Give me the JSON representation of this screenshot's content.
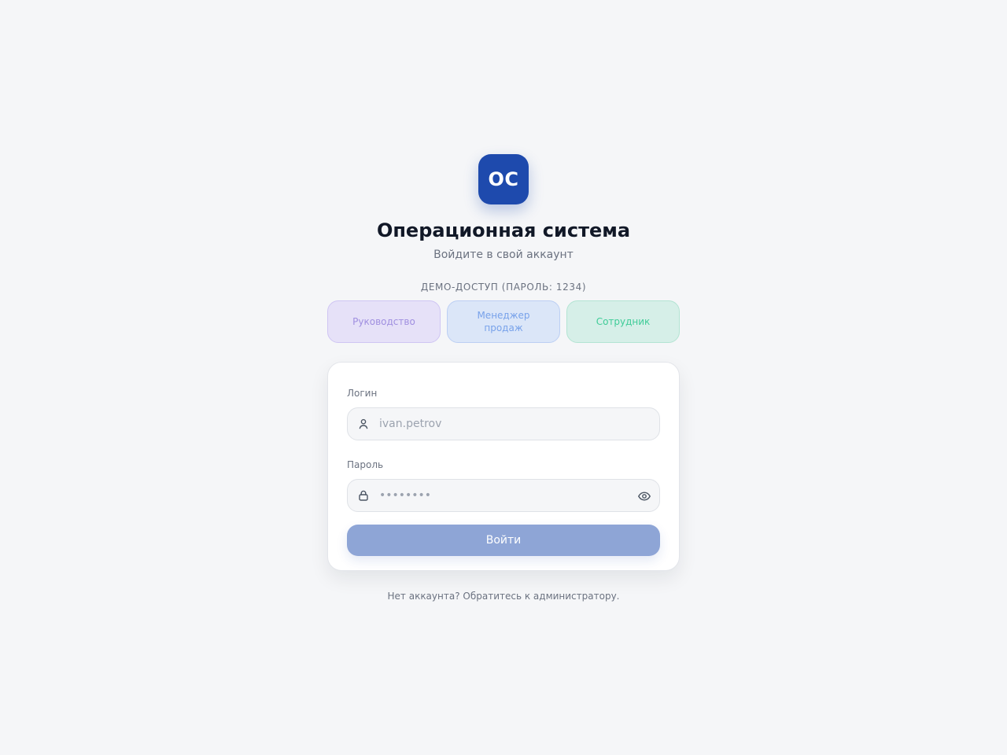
{
  "app": {
    "logo_text": "ОС",
    "title": "Операционная система",
    "subtitle": "Войдите в свой аккаунт"
  },
  "demo": {
    "label": "ДЕМО-ДОСТУП (ПАРОЛЬ: 1234)",
    "roles": [
      {
        "label": "Руководство"
      },
      {
        "label": "Менеджер продаж"
      },
      {
        "label": "Сотрудник"
      }
    ]
  },
  "form": {
    "login_label": "Логин",
    "login_placeholder": "ivan.petrov",
    "login_value": "",
    "password_label": "Пароль",
    "password_placeholder": "••••••••",
    "password_value": "",
    "submit_label": "Войти"
  },
  "footer": {
    "text": "Нет аккаунта? Обратитесь к администратору."
  },
  "colors": {
    "brand": "#1e4aad",
    "submit_disabled": "#8ea5d6",
    "role_management": "#a08fe0",
    "role_sales": "#78a2ea",
    "role_employee": "#3fcc98"
  },
  "icons": {
    "login": "user-icon",
    "password": "lock-icon",
    "toggle_password": "eye-icon"
  }
}
